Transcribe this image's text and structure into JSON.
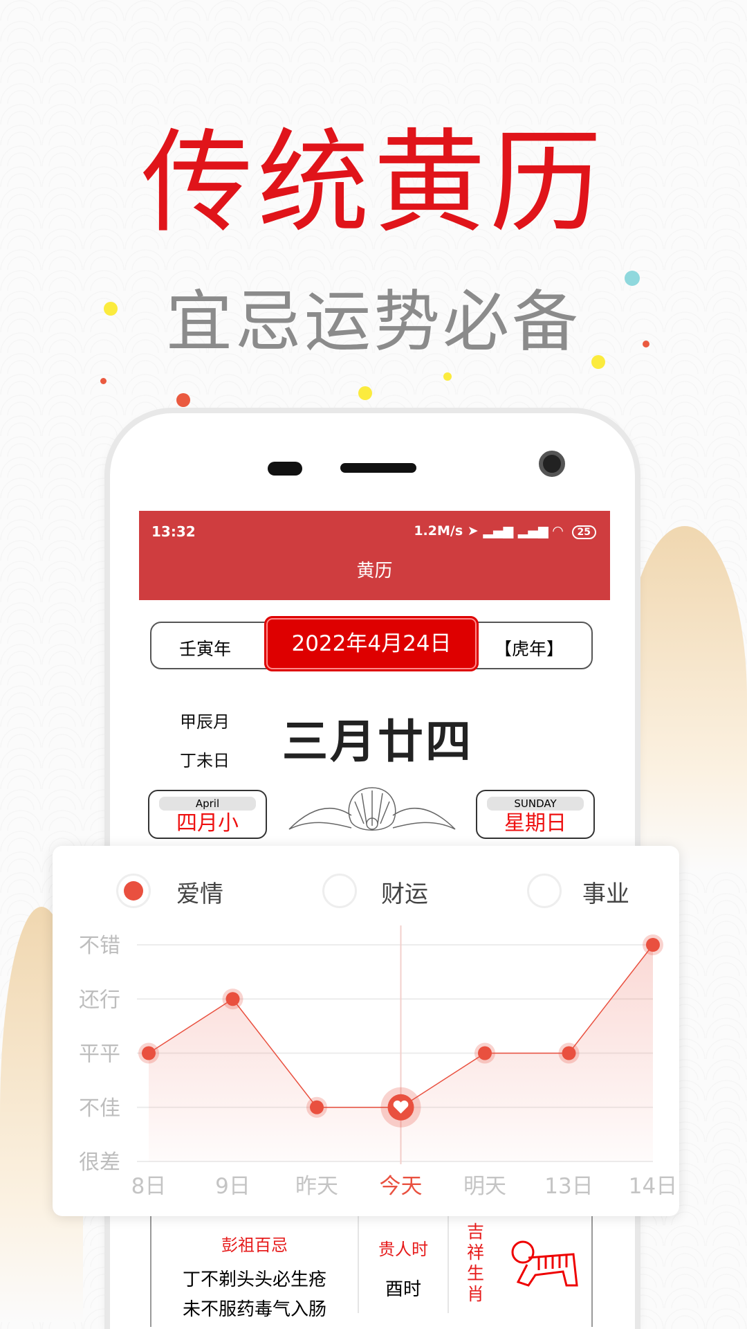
{
  "promo": {
    "title": "传统黄历",
    "subtitle": "宜忌运势必备"
  },
  "status_bar": {
    "time": "13:32",
    "network_speed": "1.2M/s",
    "battery": "25"
  },
  "app": {
    "title": "黄历"
  },
  "date_row": {
    "year_ganzhi": "壬寅年",
    "date": "2022年4月24日",
    "zodiac_year": "【虎年】"
  },
  "lunar": {
    "month_ganzhi": "甲辰月",
    "day_ganzhi": "丁未日",
    "lunar_date": "三月廿四"
  },
  "month_box": {
    "en": "April",
    "cn": "四月小"
  },
  "weekday_box": {
    "en": "SUNDAY",
    "cn": "星期日"
  },
  "fortune": {
    "tabs": [
      {
        "label": "爱情",
        "selected": true
      },
      {
        "label": "财运",
        "selected": false
      },
      {
        "label": "事业",
        "selected": false
      }
    ],
    "accent": "#e9503f"
  },
  "chart_data": {
    "type": "line",
    "y_levels": [
      "很差",
      "不佳",
      "平平",
      "还行",
      "不错"
    ],
    "categories": [
      "8日",
      "9日",
      "昨天",
      "今天",
      "明天",
      "13日",
      "14日"
    ],
    "values": [
      "平平",
      "还行",
      "不佳",
      "不佳",
      "平平",
      "平平",
      "不错"
    ],
    "highlight": "今天",
    "grid": true,
    "color": "#e9503f"
  },
  "table": {
    "pengzu": {
      "title": "彭祖百忌",
      "lines": [
        "丁不剃头头必生疮",
        "未不服药毒气入肠"
      ]
    },
    "guiren": {
      "title": "贵人时",
      "value": "酉时"
    },
    "zodiac": {
      "title": "吉祥生肖"
    }
  }
}
